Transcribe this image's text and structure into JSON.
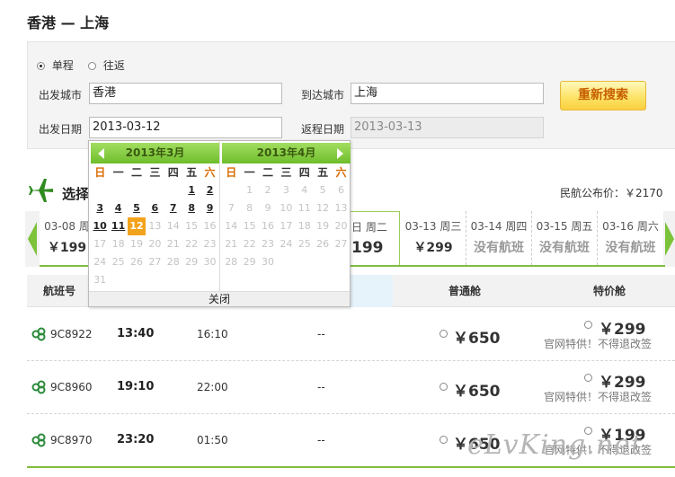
{
  "route_title": "香港 — 上海",
  "search": {
    "trip_types": [
      {
        "label": "单程",
        "checked": true
      },
      {
        "label": "往返",
        "checked": false
      }
    ],
    "from_label": "出发城市",
    "from_value": "香港",
    "to_label": "到达城市",
    "to_value": "上海",
    "depart_label": "出发日期",
    "depart_value": "2013-03-12",
    "return_label": "返程日期",
    "return_value": "2013-03-13",
    "button_label": "重新搜索"
  },
  "section": {
    "title": "选择",
    "public_price": "民航公布价：￥2170",
    "plane_icon": "plane-icon"
  },
  "date_strip": [
    {
      "date": "03-08 周",
      "price": "￥199"
    },
    {
      "date": "日 周二",
      "price": "199",
      "active": true
    },
    {
      "date": "03-13 周三",
      "price": "￥299"
    },
    {
      "date": "03-14 周四",
      "price": "没有航班"
    },
    {
      "date": "03-15 周五",
      "price": "没有航班"
    },
    {
      "date": "03-16 周六",
      "price": "没有航班"
    }
  ],
  "table": {
    "headers": {
      "flight": "航班号",
      "economy": "普通舱",
      "special": "特价舱"
    },
    "rows": [
      {
        "flight": "9C8922",
        "dep": "13:40",
        "arr": "16:10",
        "stop": "--",
        "economy": "￥650",
        "special": "￥299",
        "note": "官网特供！不得退改签"
      },
      {
        "flight": "9C8960",
        "dep": "19:10",
        "arr": "22:00",
        "stop": "--",
        "economy": "￥650",
        "special": "￥299",
        "note": "官网特供！不得退改签"
      },
      {
        "flight": "9C8970",
        "dep": "23:20",
        "arr": "01:50",
        "stop": "--",
        "economy": "￥650",
        "special": "￥199",
        "note": "官网特供！不得退改签"
      }
    ]
  },
  "calendar": {
    "weekdays": [
      "日",
      "一",
      "二",
      "三",
      "四",
      "五",
      "六"
    ],
    "months": [
      {
        "title": "2013年3月",
        "first_weekday": 5,
        "days": 31,
        "available": [
          1,
          2,
          3,
          4,
          5,
          6,
          7,
          8,
          9,
          10,
          11
        ],
        "selected": 12
      },
      {
        "title": "2013年4月",
        "first_weekday": 1,
        "days": 30,
        "available": [],
        "selected": null
      }
    ],
    "close_label": "关闭"
  },
  "watermark": "eLvKing.net",
  "colors": {
    "accent_green": "#81bd3f",
    "button_text": "#c65f00",
    "selected_day": "#f3a31b"
  }
}
